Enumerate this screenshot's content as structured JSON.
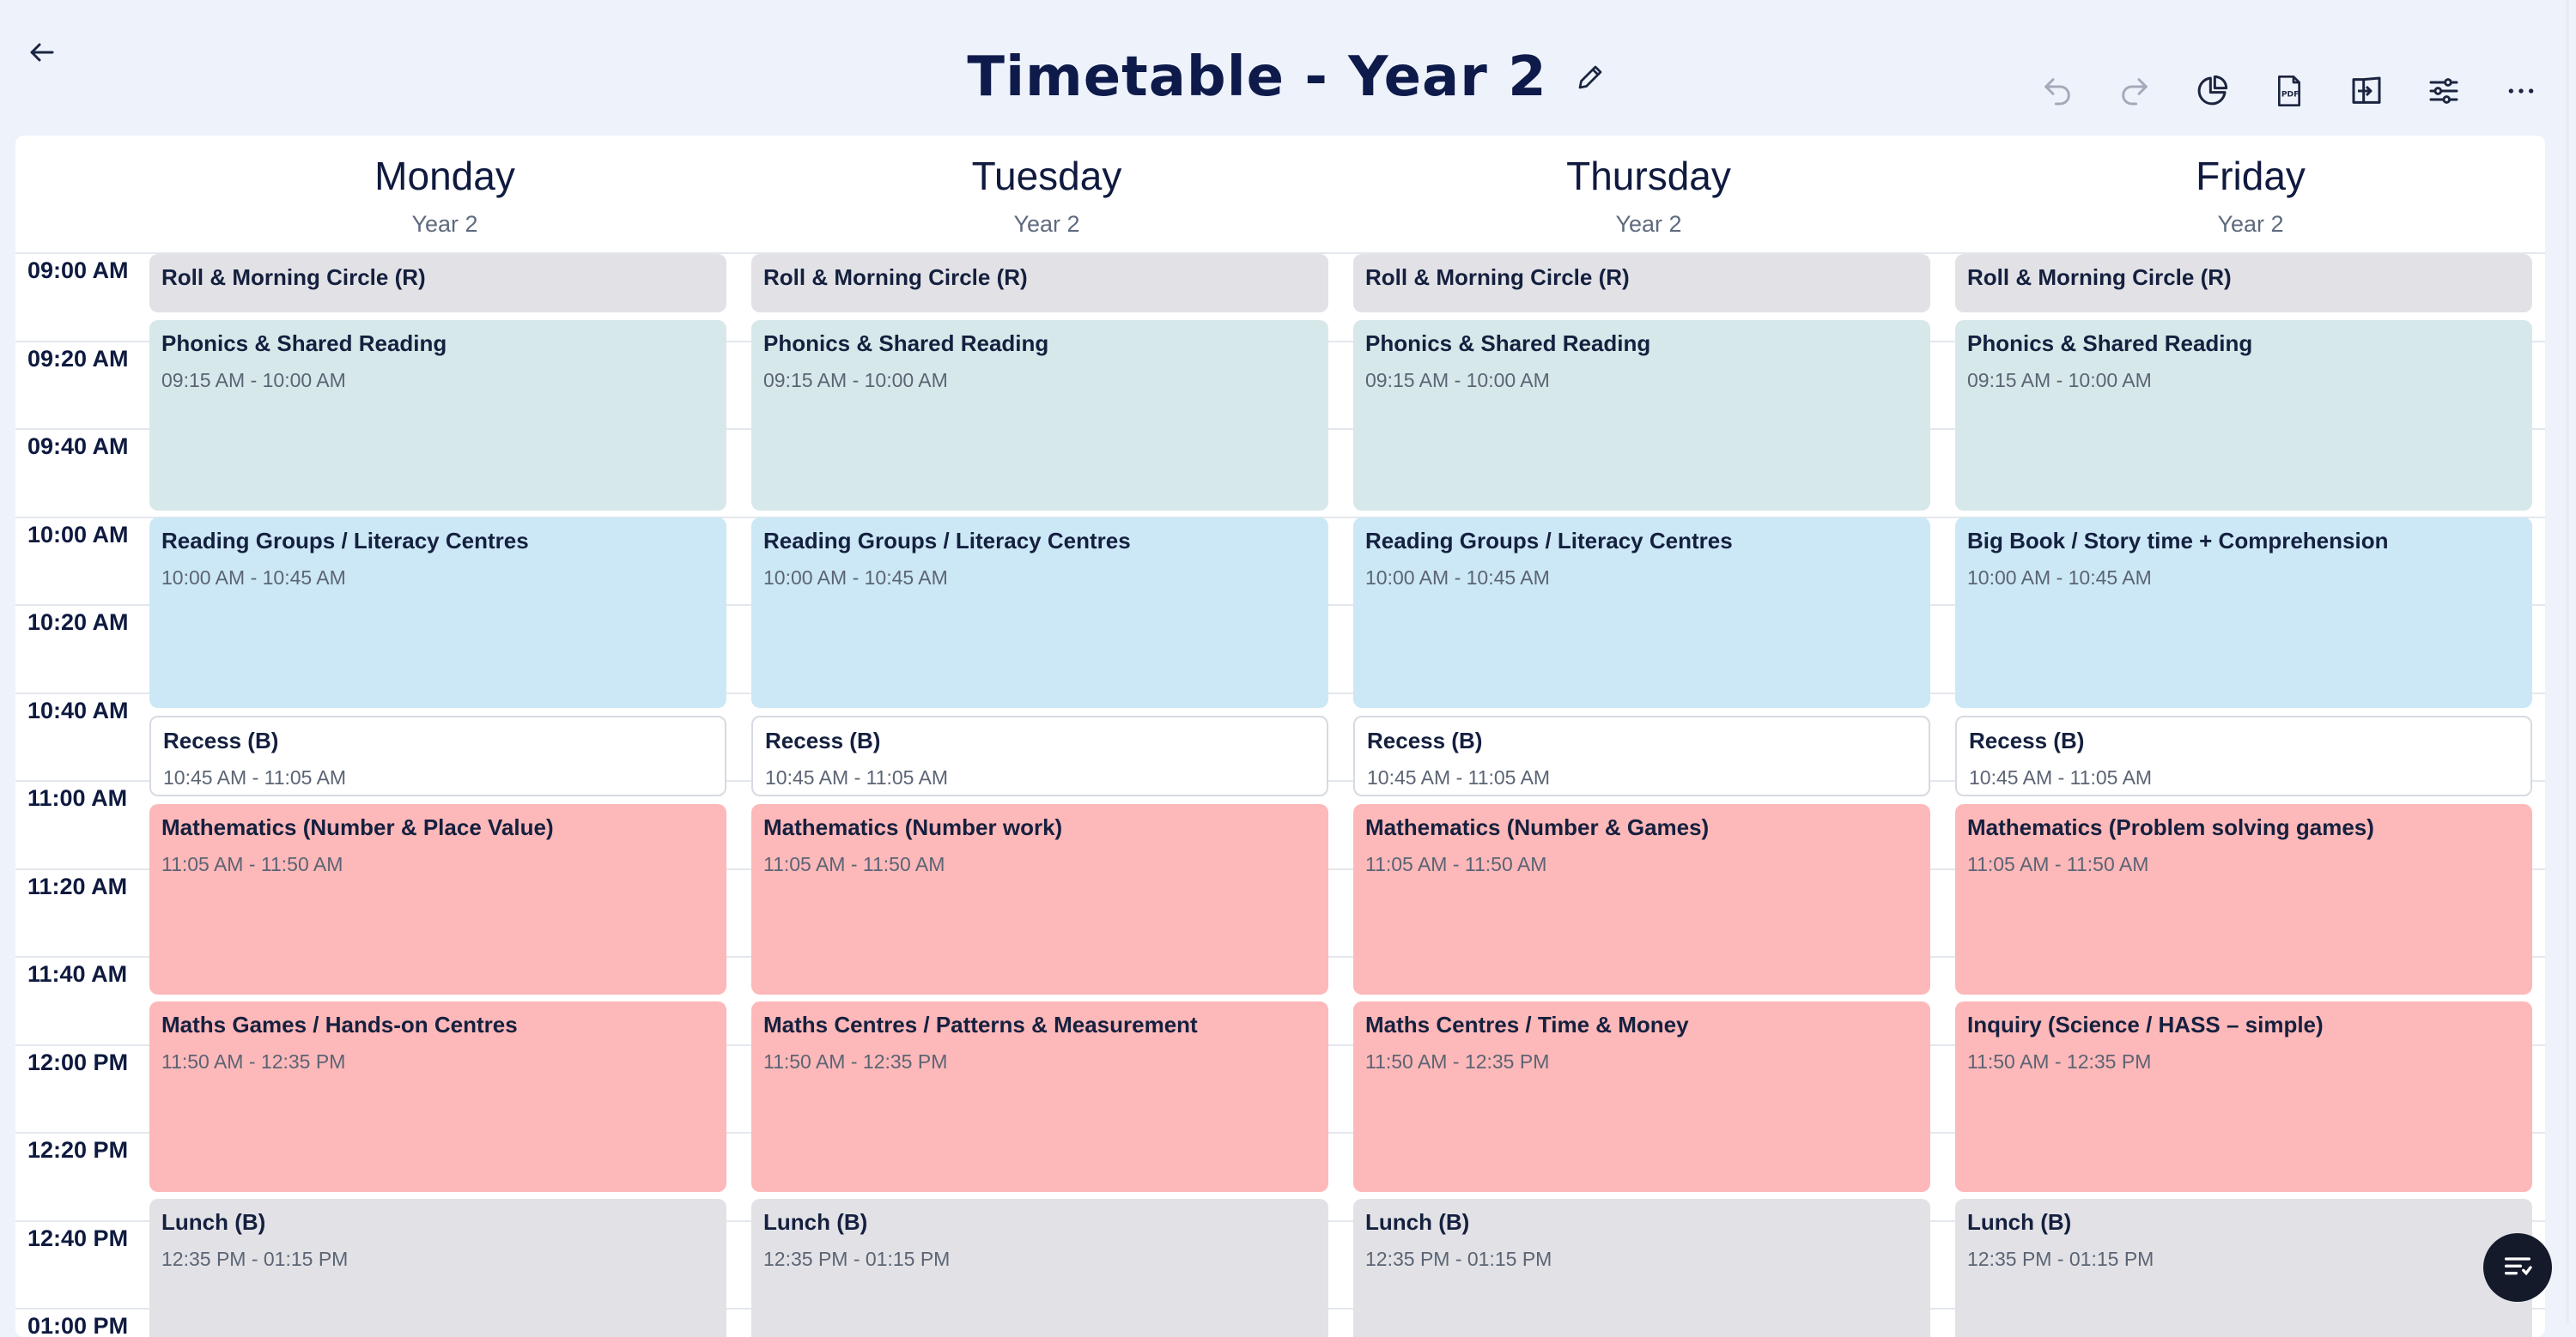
{
  "header": {
    "title": "Timetable - Year 2"
  },
  "days": [
    {
      "name": "Monday",
      "sub": "Year 2"
    },
    {
      "name": "Tuesday",
      "sub": "Year 2"
    },
    {
      "name": "Thursday",
      "sub": "Year 2"
    },
    {
      "name": "Friday",
      "sub": "Year 2"
    }
  ],
  "time_labels": [
    "09:00 AM",
    "09:20 AM",
    "09:40 AM",
    "10:00 AM",
    "10:20 AM",
    "10:40 AM",
    "11:00 AM",
    "11:20 AM",
    "11:40 AM",
    "12:00 PM",
    "12:20 PM",
    "12:40 PM",
    "01:00 PM"
  ],
  "events": {
    "monday": [
      {
        "title": "Roll & Morning Circle (R)",
        "time": ""
      },
      {
        "title": "Phonics & Shared Reading",
        "time": "09:15 AM - 10:00 AM"
      },
      {
        "title": "Reading Groups / Literacy Centres",
        "time": "10:00 AM - 10:45 AM"
      },
      {
        "title": "Recess (B)",
        "time": "10:45 AM - 11:05 AM"
      },
      {
        "title": "Mathematics (Number & Place Value)",
        "time": "11:05 AM - 11:50 AM"
      },
      {
        "title": "Maths Games / Hands-on Centres",
        "time": "11:50 AM - 12:35 PM"
      },
      {
        "title": "Lunch (B)",
        "time": "12:35 PM - 01:15 PM"
      }
    ],
    "tuesday": [
      {
        "title": "Roll & Morning Circle (R)",
        "time": ""
      },
      {
        "title": "Phonics & Shared Reading",
        "time": "09:15 AM - 10:00 AM"
      },
      {
        "title": "Reading Groups / Literacy Centres",
        "time": "10:00 AM - 10:45 AM"
      },
      {
        "title": "Recess (B)",
        "time": "10:45 AM - 11:05 AM"
      },
      {
        "title": "Mathematics (Number work)",
        "time": "11:05 AM - 11:50 AM"
      },
      {
        "title": "Maths Centres / Patterns & Measurement",
        "time": "11:50 AM - 12:35 PM"
      },
      {
        "title": "Lunch (B)",
        "time": "12:35 PM - 01:15 PM"
      }
    ],
    "thursday": [
      {
        "title": "Roll & Morning Circle (R)",
        "time": ""
      },
      {
        "title": "Phonics & Shared Reading",
        "time": "09:15 AM - 10:00 AM"
      },
      {
        "title": "Reading Groups / Literacy Centres",
        "time": "10:00 AM - 10:45 AM"
      },
      {
        "title": "Recess (B)",
        "time": "10:45 AM - 11:05 AM"
      },
      {
        "title": "Mathematics (Number & Games)",
        "time": "11:05 AM - 11:50 AM"
      },
      {
        "title": "Maths Centres / Time & Money",
        "time": "11:50 AM - 12:35 PM"
      },
      {
        "title": "Lunch (B)",
        "time": "12:35 PM - 01:15 PM"
      }
    ],
    "friday": [
      {
        "title": "Roll & Morning Circle (R)",
        "time": ""
      },
      {
        "title": "Phonics & Shared Reading",
        "time": "09:15 AM - 10:00 AM"
      },
      {
        "title": "Big Book / Story time + Comprehension",
        "time": "10:00 AM - 10:45 AM"
      },
      {
        "title": "Recess (B)",
        "time": "10:45 AM - 11:05 AM"
      },
      {
        "title": "Mathematics (Problem solving games)",
        "time": "11:05 AM - 11:50 AM"
      },
      {
        "title": "Inquiry (Science / HASS – simple)",
        "time": "11:50 AM - 12:35 PM"
      },
      {
        "title": "Lunch (B)",
        "time": "12:35 PM - 01:15 PM"
      }
    ]
  },
  "icons": {
    "back": "arrow-left-icon",
    "edit": "pencil-icon",
    "toolbar": [
      "undo-icon",
      "redo-icon",
      "pie-chart-icon",
      "pdf-icon",
      "open-book-icon",
      "sliders-icon",
      "more-icon"
    ],
    "fab": "list-filter-icon"
  },
  "colors": {
    "roll": "#e2e2e6",
    "phonics": "#d7e8ea",
    "reading": "#cce8f6",
    "recess": "#ffffff",
    "maths": "#fdb8b9",
    "lunch": "#e2e2e6",
    "title": "#0e1a4a"
  }
}
